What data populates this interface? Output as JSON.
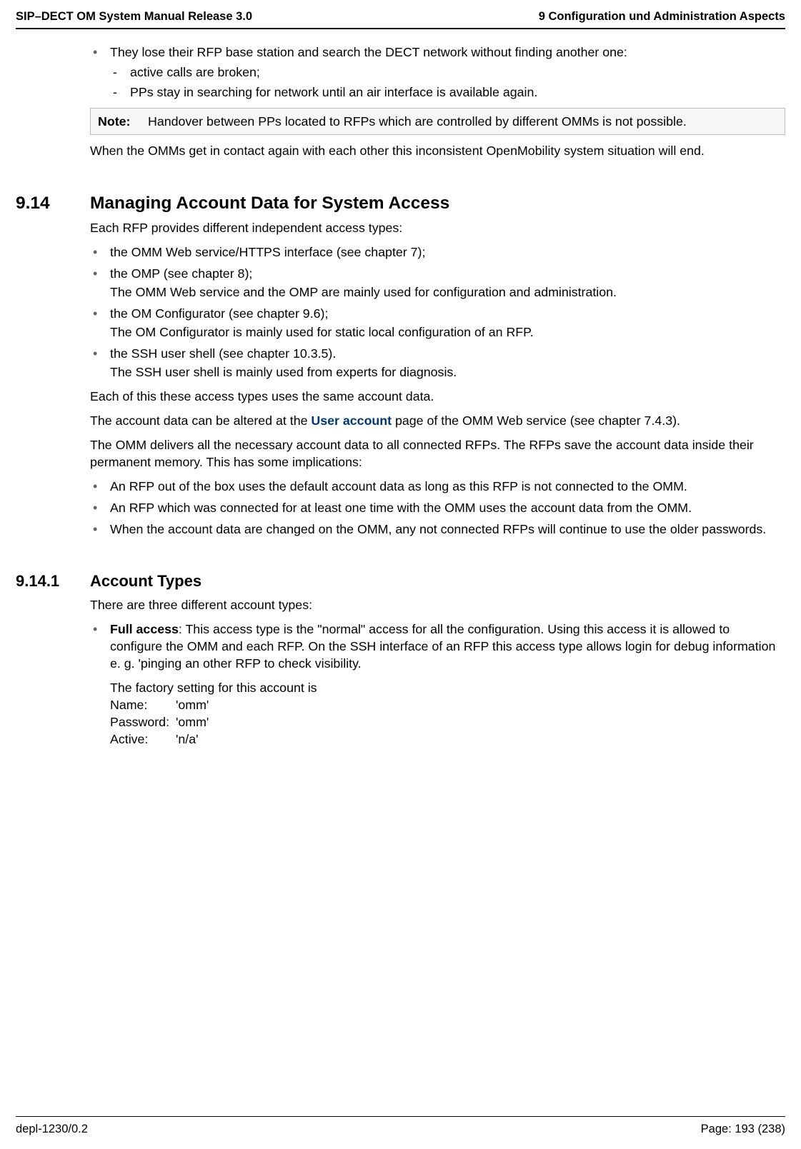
{
  "header": {
    "left": "SIP–DECT OM System Manual Release 3.0",
    "right": "9 Configuration und Administration Aspects"
  },
  "top_bullets": {
    "b1": "They lose their RFP base station and search the DECT network without finding another one:",
    "d1": "active calls are broken;",
    "d2": "PPs stay in searching for network until an air interface is available again."
  },
  "note": {
    "label": "Note:",
    "text": "Handover between PPs located to RFPs which are controlled by different OMMs is not possible."
  },
  "para1": "When the OMMs get in contact again with each other this inconsistent OpenMobility system situation will end.",
  "s914": {
    "num": "9.14",
    "title": "Managing Account Data for System Access",
    "intro": "Each RFP provides different independent access types:",
    "b1": "the OMM Web service/HTTPS interface (see chapter 7);",
    "b2": "the OMP (see chapter 8);",
    "b2_sub": "The OMM Web service and the OMP are mainly used for configuration and administration.",
    "b3": "the OM Configurator (see chapter 9.6);",
    "b3_sub": "The OM Configurator is mainly used for static local configuration of an RFP.",
    "b4": "the SSH user shell (see chapter 10.3.5).",
    "b4_sub": "The SSH user shell is mainly used from experts for diagnosis.",
    "p1": "Each of this these access types uses the same account data.",
    "p2_pre": "The account data can be altered at the ",
    "p2_link": "User account",
    "p2_post": " page of the OMM Web service (see chapter 7.4.3).",
    "p3": "The OMM delivers all the necessary account data to all connected RFPs. The RFPs save the account data inside their permanent memory. This has some implications:",
    "i1": "An RFP out of the box uses the default account data as long as this RFP is not connected to the OMM.",
    "i2": "An RFP which was connected for at least one time with the OMM uses the account data from the OMM.",
    "i3": "When the account data are changed on the OMM, any not connected RFPs will continue to use the older passwords."
  },
  "s9141": {
    "num": "9.14.1",
    "title": "Account Types",
    "intro": "There are three different account types:",
    "full_label": "Full access",
    "full_text": ": This access type is the \"normal\" access for all the configuration. Using this access it is allowed to configure the OMM and each RFP. On the SSH interface of an RFP this access type allows login for debug information e. g. 'pinging an other RFP to check visibility.",
    "factory": "The factory setting for this account is",
    "name_l": "Name:",
    "name_v": "'omm'",
    "pass_l": "Password:",
    "pass_v": "'omm'",
    "active_l": "Active:",
    "active_v": "'n/a'"
  },
  "footer": {
    "left": "depl-1230/0.2",
    "right": "Page: 193 (238)"
  }
}
